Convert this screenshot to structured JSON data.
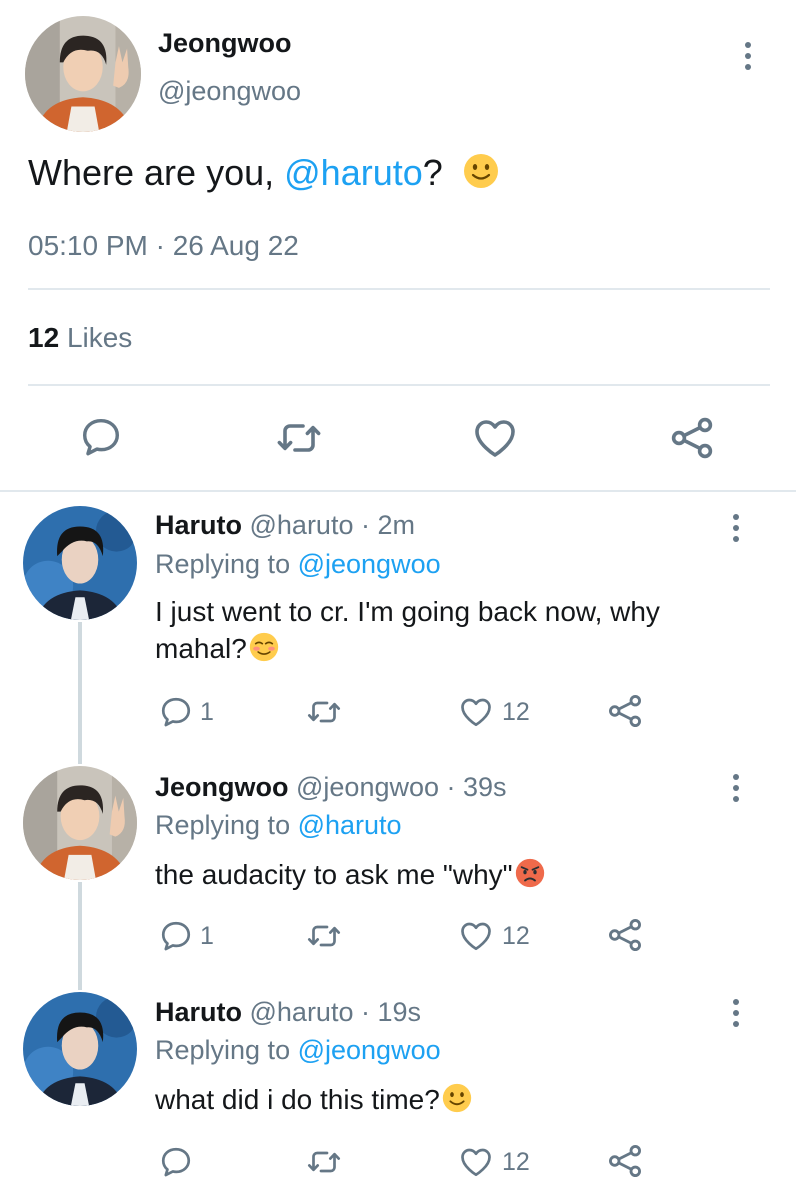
{
  "main_tweet": {
    "name": "Jeongwoo",
    "handle": "@jeongwoo",
    "text_before": "Where are you, ",
    "mention": "@haruto",
    "text_after": "?",
    "timestamp": "05:10 PM · 26 Aug 22",
    "likes_count": "12",
    "likes_label": "Likes"
  },
  "replies": [
    {
      "name": "Haruto",
      "meta": " @haruto · 2m",
      "replying_label": "Replying to ",
      "replying_to": "@jeongwoo",
      "text_line1": "I just went to cr. I'm going back now, why",
      "text_line2": "mahal?",
      "reply_count": "1",
      "like_count": "12"
    },
    {
      "name": "Jeongwoo",
      "meta": " @jeongwoo · 39s",
      "replying_label": "Replying to ",
      "replying_to": "@haruto",
      "text_line1": "the audacity to ask me \"why\"",
      "reply_count": "1",
      "like_count": "12"
    },
    {
      "name": "Haruto",
      "meta": " @haruto · 19s",
      "replying_label": "Replying to ",
      "replying_to": "@jeongwoo",
      "text_line1": "what did i do this time?",
      "like_count": "12"
    }
  ],
  "icons": [
    "more-icon",
    "reply-icon",
    "retweet-icon",
    "like-icon",
    "share-icon",
    "smile-emoji",
    "blush-emoji",
    "angry-emoji"
  ],
  "colors": {
    "accent": "#1da1f2",
    "muted": "#657786",
    "text": "#14171a",
    "divider": "#e1e8ed"
  }
}
